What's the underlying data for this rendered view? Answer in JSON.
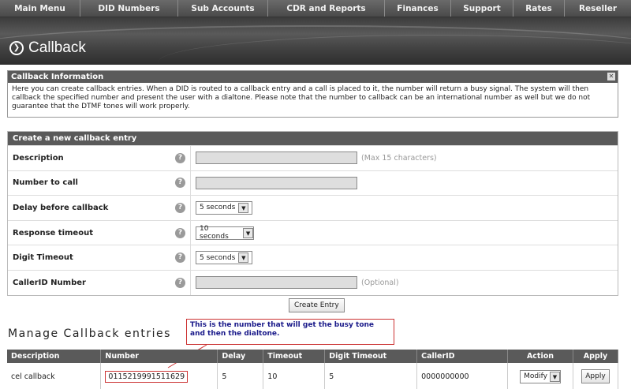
{
  "nav": {
    "items": [
      "Main Menu",
      "DID Numbers",
      "Sub Accounts",
      "CDR and Reports",
      "Finances",
      "Support",
      "Rates",
      "Reseller"
    ]
  },
  "header": {
    "title": "Callback",
    "title_icon": "circle-chevron-right-icon"
  },
  "info": {
    "heading": "Callback Information",
    "close_icon": "close-icon",
    "text": "Here you can create callback entries. When a DID is routed to a callback entry and a call is placed to it, the number will return a busy signal. The system will then callback the specified number and present the user with a dialtone. Please note that the number to callback can be an international number as well but we do not guarantee that the DTMF tones will work properly."
  },
  "create": {
    "heading": "Create a new callback entry",
    "rows": [
      {
        "label": "Description",
        "hint": "(Max 15 characters)"
      },
      {
        "label": "Number to call",
        "hint": ""
      },
      {
        "label": "Delay before callback",
        "select": "5 seconds"
      },
      {
        "label": "Response timeout",
        "select": "10 seconds"
      },
      {
        "label": "Digit Timeout",
        "select": "5 seconds"
      },
      {
        "label": "CallerID Number",
        "hint": "(Optional)"
      }
    ],
    "button": "Create Entry"
  },
  "manage": {
    "title": "Manage Callback entries",
    "callout": "This is the number that will get the busy tone and then the dialtone.",
    "columns": [
      "Description",
      "Number",
      "Delay",
      "Timeout",
      "Digit Timeout",
      "CallerID",
      "Action",
      "Apply"
    ],
    "rows": [
      {
        "description": "cel callback",
        "number": "0115219991511629",
        "delay": "5",
        "timeout": "10",
        "digit_timeout": "5",
        "callerid": "0000000000",
        "action": "Modify",
        "apply": "Apply"
      }
    ]
  },
  "colors": {
    "header_bg": "#5a5a5a",
    "callout_border": "#cc3333",
    "callout_text": "#1a1a8a"
  }
}
